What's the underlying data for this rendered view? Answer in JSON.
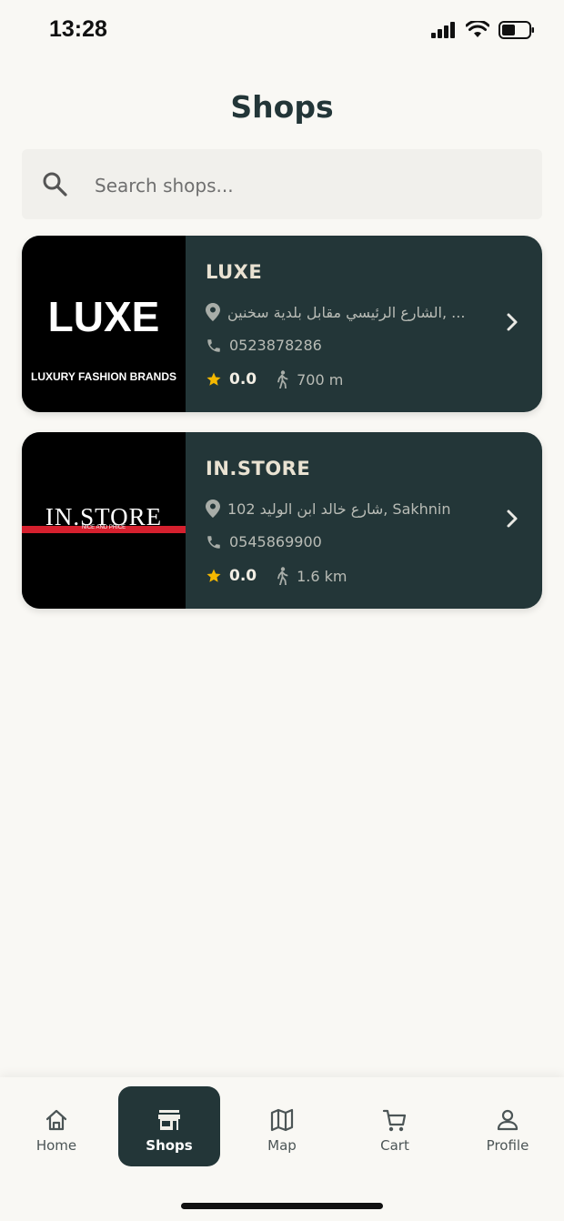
{
  "status_bar": {
    "time": "13:28"
  },
  "page_title": "Shops",
  "search": {
    "placeholder": "Search shops...",
    "value": ""
  },
  "shops": [
    {
      "name": "LUXE",
      "logo_title": "LUXE",
      "logo_subtitle": "LUXURY FASHION BRANDS",
      "address": "الشارع الرئيسي مقابل بلدية سخنين, ...",
      "phone": "0523878286",
      "rating": "0.0",
      "distance": "700 m"
    },
    {
      "name": "IN.STORE",
      "logo_title": "IN.STORE",
      "logo_subtitle": "NICE AND PRICE",
      "address": "102 شارع خالد ابن الوليد, Sakhnin",
      "phone": "0545869900",
      "rating": "0.0",
      "distance": "1.6 km"
    }
  ],
  "nav": [
    {
      "label": "Home",
      "icon": "home-icon",
      "active": false
    },
    {
      "label": "Shops",
      "icon": "store-icon",
      "active": true
    },
    {
      "label": "Map",
      "icon": "map-icon",
      "active": false
    },
    {
      "label": "Cart",
      "icon": "cart-icon",
      "active": false
    },
    {
      "label": "Profile",
      "icon": "person-icon",
      "active": false
    }
  ],
  "colors": {
    "primary": "#233638",
    "background": "#f9f8f4",
    "star": "#f5b800",
    "accent_red": "#d5202e"
  }
}
